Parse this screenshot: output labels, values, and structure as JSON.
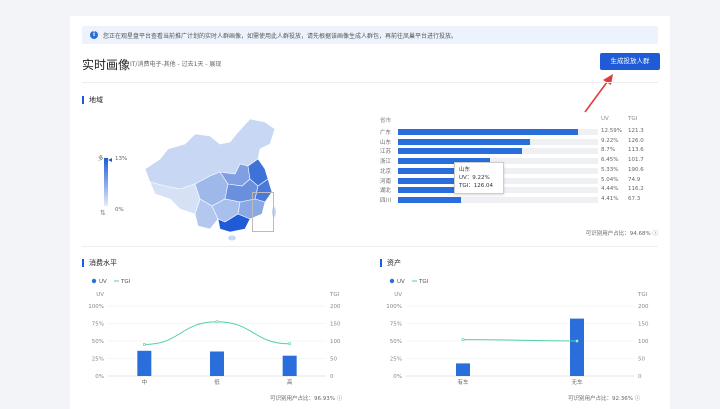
{
  "notice": {
    "text": "您正在观星盘平台查看当前推广计划的实时人群画像，如需使用此人群投放，请先根据该画像生成人群包，再前往凤巢平台进行投放。",
    "icon": "info-icon"
  },
  "header": {
    "title": "实时画像",
    "subtitle": "IT/消费电子-其他 - 过去1天 - 展现",
    "button": "生成投放人群"
  },
  "region": {
    "title": "地域",
    "legend_max": "13%",
    "legend_min": "0%",
    "legend_label": "多",
    "columns": {
      "province": "省市",
      "uv": "UV",
      "tgi": "TGI"
    },
    "rows": [
      {
        "name": "广东",
        "uv": "12.59%",
        "tgi": "121.3",
        "value": 12.59
      },
      {
        "name": "山东",
        "uv": "9.22%",
        "tgi": "126.0",
        "value": 9.22
      },
      {
        "name": "江苏",
        "uv": "8.7%",
        "tgi": "113.6",
        "value": 8.7
      },
      {
        "name": "浙江",
        "uv": "6.45%",
        "tgi": "101.7",
        "value": 6.45
      },
      {
        "name": "北京",
        "uv": "5.33%",
        "tgi": "190.6",
        "value": 5.33
      },
      {
        "name": "河南",
        "uv": "5.04%",
        "tgi": "74.9",
        "value": 5.04
      },
      {
        "name": "湖北",
        "uv": "4.44%",
        "tgi": "116.2",
        "value": 4.44
      },
      {
        "name": "四川",
        "uv": "4.41%",
        "tgi": "67.3",
        "value": 4.41
      }
    ],
    "tooltip": {
      "title": "山东",
      "uv": "UV：9.22%",
      "tgi": "TGI：126.04"
    },
    "coverage": "可识别用户占比：94.68%"
  },
  "consumption": {
    "title": "消费水平",
    "coverage": "可识别用户占比：96.93%",
    "chart_data": {
      "type": "bar",
      "categories": [
        "中",
        "低",
        "高"
      ],
      "series": [
        {
          "name": "UV",
          "values": [
            36,
            35,
            29
          ],
          "axis": "left"
        },
        {
          "name": "TGI",
          "values": [
            90,
            155,
            92
          ],
          "axis": "right",
          "type": "line"
        }
      ],
      "ylim_left": [
        0,
        100
      ],
      "ylim_right": [
        0,
        200
      ],
      "yticks_left": [
        "100%",
        "75%",
        "50%",
        "25%",
        "0%"
      ],
      "yticks_right": [
        "200",
        "150",
        "100",
        "50",
        "0"
      ],
      "ylabel_left": "UV",
      "ylabel_right": "TGI",
      "colors": {
        "UV": "#2a6edb",
        "TGI": "#4fd1a5"
      }
    }
  },
  "assets": {
    "title": "资产",
    "coverage": "可识别用户占比：92.36%",
    "chart_data": {
      "type": "bar",
      "categories": [
        "有车",
        "无车"
      ],
      "series": [
        {
          "name": "UV",
          "values": [
            18,
            82
          ],
          "axis": "left"
        },
        {
          "name": "TGI",
          "values": [
            104,
            100
          ],
          "axis": "right",
          "type": "line"
        }
      ],
      "ylim_left": [
        0,
        100
      ],
      "ylim_right": [
        0,
        200
      ],
      "yticks_left": [
        "100%",
        "75%",
        "50%",
        "25%",
        "0%"
      ],
      "yticks_right": [
        "200",
        "150",
        "100",
        "50",
        "0"
      ],
      "ylabel_left": "UV",
      "ylabel_right": "TGI",
      "colors": {
        "UV": "#2a6edb",
        "TGI": "#4fd1a5"
      }
    }
  }
}
